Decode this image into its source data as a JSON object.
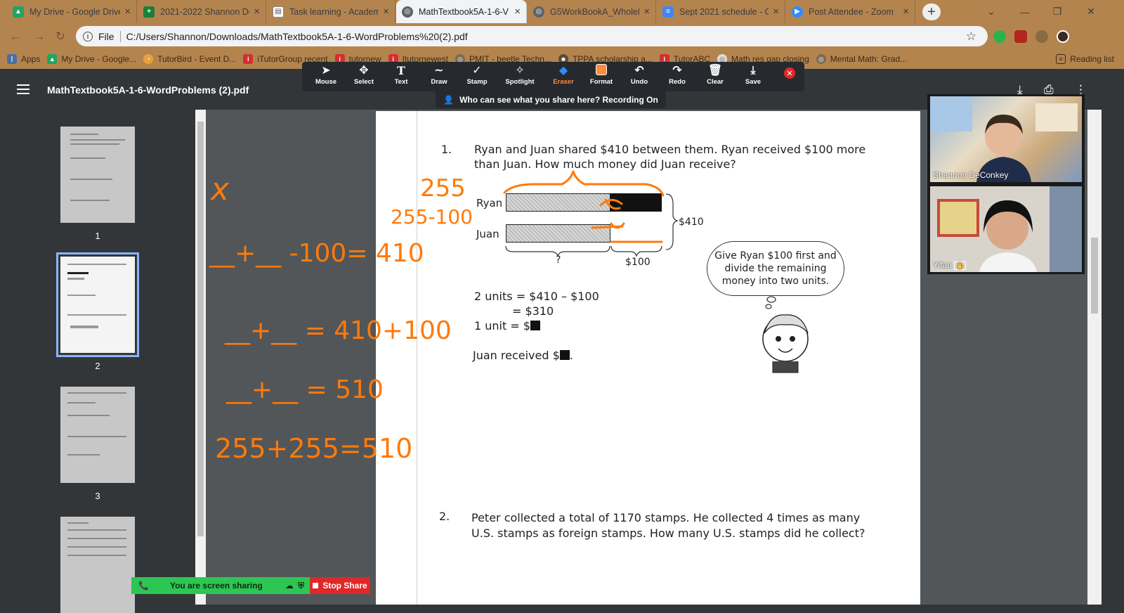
{
  "browser": {
    "tabs": [
      {
        "label": "My Drive - Google Drive",
        "icon": "google-drive-icon",
        "color": "#1fa463"
      },
      {
        "label": "2021-2022 Shannon De",
        "icon": "google-sheets-icon",
        "color": "#188038"
      },
      {
        "label": "Task learning - Academ",
        "icon": "document-icon",
        "color": "#555555"
      },
      {
        "label": "MathTextbook5A-1-6-V",
        "icon": "globe-icon",
        "color": "#5f6368"
      },
      {
        "label": "G5WorkBookA_WholeN",
        "icon": "globe-icon",
        "color": "#5f6368"
      },
      {
        "label": "Sept 2021 schedule - G",
        "icon": "google-docs-icon",
        "color": "#4285f4"
      },
      {
        "label": "Post Attendee - Zoom",
        "icon": "zoom-icon",
        "color": "#2d8cff"
      }
    ],
    "new_tab": "+",
    "address": {
      "scheme": "File",
      "url": "C:/Users/Shannon/Downloads/MathTextbook5A-1-6-WordProblems%20(2).pdf"
    },
    "bookmarks": [
      {
        "label": "Apps",
        "icon": "apps-grid-icon"
      },
      {
        "label": "My Drive - Google...",
        "icon": "google-drive-icon"
      },
      {
        "label": "TutorBird - Event D...",
        "icon": "tutorbird-icon"
      },
      {
        "label": "iTutorGroup recent",
        "icon": "itutor-icon"
      },
      {
        "label": "tutornew",
        "icon": "itutor-icon"
      },
      {
        "label": "Itutornewest",
        "icon": "itutor-icon"
      },
      {
        "label": "PMIT - beetle Techn...",
        "icon": "globe-icon"
      },
      {
        "label": "TPPA scholarship a...",
        "icon": "tppa-icon"
      },
      {
        "label": "TutorABC",
        "icon": "itutor-icon"
      },
      {
        "label": "Math res gap closing",
        "icon": "globe-icon"
      },
      {
        "label": "Mental Math: Grad...",
        "icon": "globe-icon"
      },
      {
        "label": "Reading list",
        "icon": "reading-list-icon"
      }
    ]
  },
  "pdf": {
    "title": "MathTextbook5A-1-6-WordProblems (2).pdf",
    "pages": [
      "1",
      "2",
      "3"
    ]
  },
  "zoom_toolbar": {
    "tools": [
      {
        "label": "Mouse",
        "icon": "cursor-icon"
      },
      {
        "label": "Select",
        "icon": "move-icon"
      },
      {
        "label": "Text",
        "icon": "text-icon"
      },
      {
        "label": "Draw",
        "icon": "draw-icon"
      },
      {
        "label": "Stamp",
        "icon": "stamp-icon"
      },
      {
        "label": "Spotlight",
        "icon": "spotlight-icon"
      },
      {
        "label": "Eraser",
        "icon": "eraser-icon"
      },
      {
        "label": "Format",
        "icon": "format-icon"
      },
      {
        "label": "Undo",
        "icon": "undo-icon"
      },
      {
        "label": "Redo",
        "icon": "redo-icon"
      },
      {
        "label": "Clear",
        "icon": "trash-icon"
      },
      {
        "label": "Save",
        "icon": "save-icon"
      }
    ],
    "recording_notice": "Who can see what you share here? Recording On",
    "active_color": "#ff8a3d"
  },
  "document": {
    "q1_number": "1.",
    "q1_text_line1": "Ryan and Juan shared $410 between them. Ryan received $100 more",
    "q1_text_line2": "than Juan. How much money did Juan receive?",
    "bar_label_ryan": "Ryan",
    "bar_label_juan": "Juan",
    "total_label": "$410",
    "unknown_label": "?",
    "diff_label": "$100",
    "bubble_text": "Give Ryan $100 first and divide the remaining money into two units.",
    "work_line1": "2 units = $410 – $100",
    "work_line2": "= $310",
    "work_line3": "1 unit = $",
    "answer_line": "Juan received $",
    "answer_end": ".",
    "q2_number": "2.",
    "q2_text_line1": "Peter collected a total of 1170 stamps. He collected 4 times as many",
    "q2_text_line2": "U.S. stamps as foreign stamps. How many U.S. stamps did he collect?"
  },
  "annotations": {
    "ink_color": "#ff7a0a",
    "handwriting": [
      "x",
      "255",
      "255-100",
      "__+__ -100= 410",
      "__+__ = 410+100",
      "__+__ = 510",
      "255+255=510",
      "x",
      "x"
    ]
  },
  "video": {
    "participants": [
      "Shannon DeConkey",
      "Yifan"
    ]
  },
  "share": {
    "status": "You are screen sharing",
    "stop_label": "Stop Share"
  }
}
